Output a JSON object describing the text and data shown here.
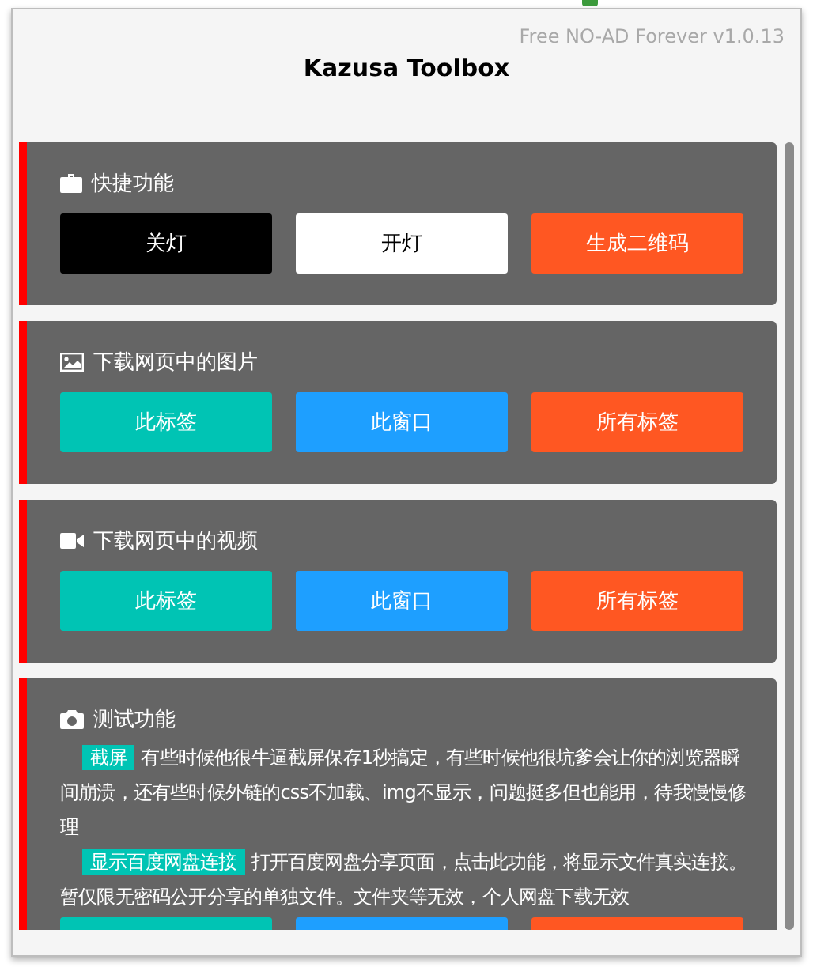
{
  "header": {
    "version": "Free NO-AD Forever v1.0.13",
    "title": "Kazusa Toolbox"
  },
  "sections": [
    {
      "title": "快捷功能",
      "buttons": [
        {
          "label": "关灯",
          "color": "#000000"
        },
        {
          "label": "开灯",
          "color": "#ffffff"
        },
        {
          "label": "生成二维码",
          "color": "#ff5722"
        }
      ]
    },
    {
      "title": "下载网页中的图片",
      "buttons": [
        {
          "label": "此标签",
          "color": "#00c4b4"
        },
        {
          "label": "此窗口",
          "color": "#1e9fff"
        },
        {
          "label": "所有标签",
          "color": "#ff5722"
        }
      ]
    },
    {
      "title": "下载网页中的视频",
      "buttons": [
        {
          "label": "此标签",
          "color": "#00c4b4"
        },
        {
          "label": "此窗口",
          "color": "#1e9fff"
        },
        {
          "label": "所有标签",
          "color": "#ff5722"
        }
      ]
    },
    {
      "title": "测试功能",
      "notes": [
        {
          "tag": "截屏",
          "text": "有些时候他很牛逼截屏保存1秒搞定，有些时候他很坑爹会让你的浏览器瞬间崩溃，还有些时候外链的css不加载、img不显示，问题挺多但也能用，待我慢慢修理"
        },
        {
          "tag": "显示百度网盘连接",
          "text": "打开百度网盘分享页面，点击此功能，将显示文件真实连接。暂仅限无密码公开分享的单独文件。文件夹等无效，个人网盘下载无效"
        }
      ],
      "buttons": [
        {
          "color": "#00c4b4"
        },
        {
          "color": "#1e9fff"
        },
        {
          "color": "#ff5722"
        }
      ]
    }
  ]
}
